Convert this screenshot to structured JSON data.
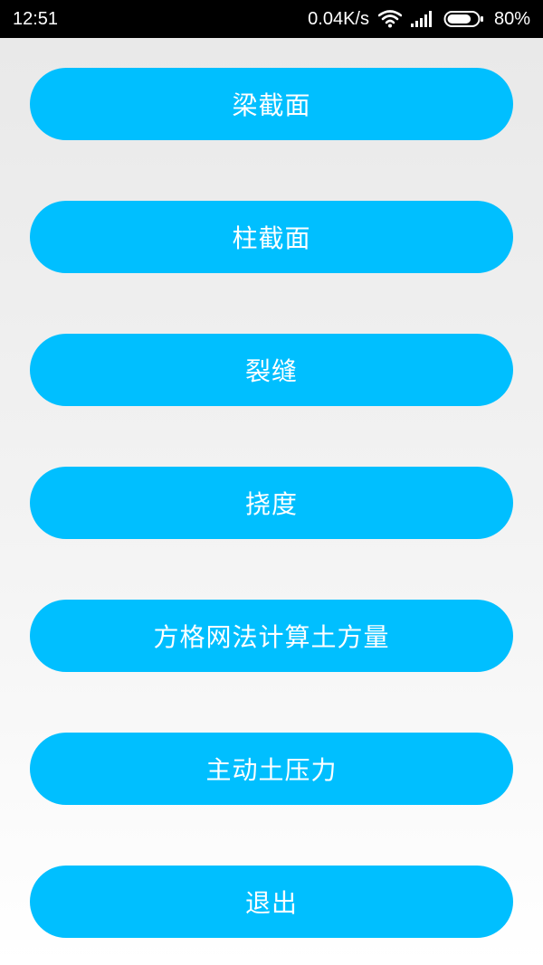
{
  "status_bar": {
    "time": "12:51",
    "network_speed": "0.04K/s",
    "battery_percent": "80%",
    "battery_level": 0.8,
    "icons": {
      "wifi": "wifi-icon",
      "signal": "signal-icon",
      "battery": "battery-icon"
    }
  },
  "colors": {
    "button_bg": "#00bfff",
    "button_text": "#ffffff",
    "status_bar_bg": "#000000"
  },
  "menu": {
    "items": [
      {
        "label": "梁截面"
      },
      {
        "label": "柱截面"
      },
      {
        "label": "裂缝"
      },
      {
        "label": "挠度"
      },
      {
        "label": "方格网法计算土方量"
      },
      {
        "label": "主动土压力"
      },
      {
        "label": "退出"
      }
    ]
  }
}
